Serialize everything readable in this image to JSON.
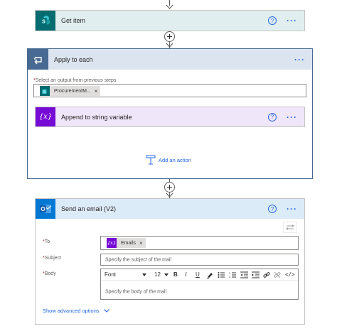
{
  "get_item": {
    "title": "Get item",
    "help": "?",
    "more": "···"
  },
  "apply": {
    "title": "Apply to each",
    "more": "···",
    "select_label": "Select an output from previous steps",
    "token_label": "ProcurementM...",
    "token_x": "×",
    "append": {
      "title": "Append to string variable",
      "help": "?",
      "more": "···",
      "icon_text": "{x}"
    },
    "add_action": "Add an action"
  },
  "email": {
    "title": "Send an email (V2)",
    "help": "?",
    "more": "···",
    "to_label": "To",
    "to_token": "Emails",
    "to_token_icon": "{x}",
    "to_token_x": "×",
    "subject_label": "Subject",
    "subject_placeholder": "Specify the subject of the mail",
    "body_label": "Body",
    "body_placeholder": "Specify the body of the mail",
    "font": "Font",
    "font_size": "12",
    "bold": "B",
    "italic": "I",
    "underline": "U",
    "code": "</>",
    "advanced": "Show advanced options"
  },
  "colors": {
    "sharepoint": "#036c70",
    "loop": "#486991",
    "variable": "#770bd6",
    "outlook": "#0078d4",
    "link": "#2266e3",
    "required": "#a4262c"
  }
}
